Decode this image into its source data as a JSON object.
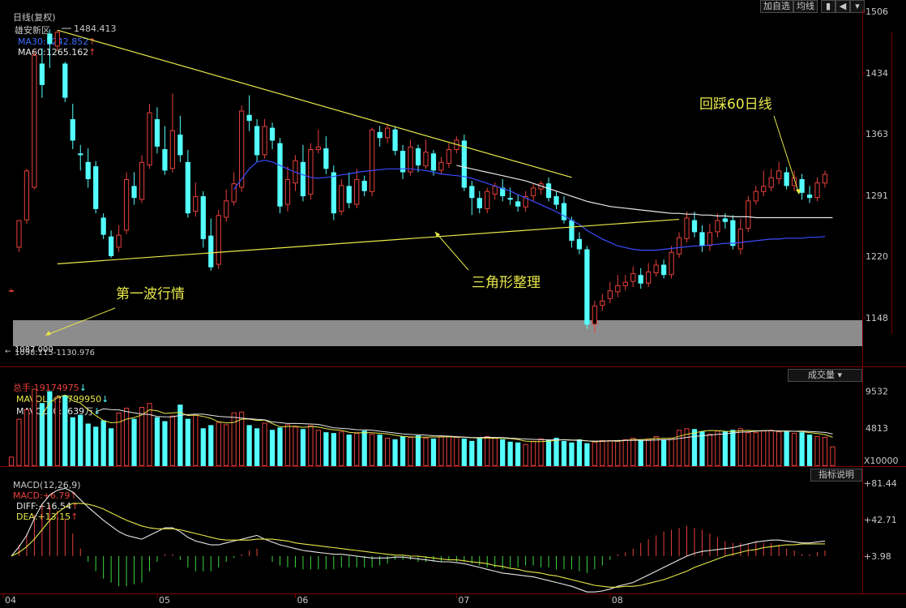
{
  "header": {
    "period_label": "日线(复权)",
    "stock_name": "雄安新区",
    "ma30_label": "MA30:",
    "ma30_value": "1242.852",
    "ma60_label": "MA60:",
    "ma60_value": "1265.162",
    "buttons": [
      "加自选",
      "均线"
    ],
    "arrow_up": "↑"
  },
  "panel_buttons": {
    "volume_type": "成交量",
    "indicator_help": "指标说明",
    "volume_unit": "X10000"
  },
  "colors": {
    "up": "#e8403c",
    "down": "#54ffff",
    "ma30": "#3a4cff",
    "ma60": "#e8e8e8",
    "trend": "#e8e84a",
    "axis": "#7a0000",
    "label_price": "#c8c8c8"
  },
  "volume_header": {
    "total_label": "总手:",
    "total_value": "19174975",
    "mavol5_label": "MAVOL5:",
    "mavol5_value": "27799950",
    "mavol30_label": "MAVOL30:",
    "mavol30_value": "3639万"
  },
  "macd_header": {
    "label": "MACD(12,26,9)",
    "macd_label": "MACD:",
    "macd_value": "+6.79",
    "diff_label": "DIFF:",
    "diff_value": "+16.54",
    "dea_label": "DEA:",
    "dea_value": "+13.15"
  },
  "annotations": {
    "high_label": "1484.413",
    "low_label": "1087.000",
    "gap_label": "1098.115-1130.976",
    "triangle": "三角形整理",
    "first_wave": "第一波行情",
    "pullback": "回踩60日线"
  },
  "chart_data": [
    {
      "type": "candlestick",
      "title": "雄安新区 日线(复权)",
      "price_axis_ticks": [
        1506,
        1434,
        1363,
        1291,
        1220,
        1148
      ],
      "ylim": [
        1100,
        1510
      ],
      "x_tick_labels": [
        "04",
        "05",
        "06",
        "07",
        "08"
      ],
      "x_tick_index": [
        0,
        19,
        37,
        58,
        78
      ],
      "candles": [
        [
          1180,
          1180,
          1178,
          1182
        ],
        [
          1230,
          1262,
          1258,
          1225
        ],
        [
          1262,
          1320,
          1322,
          1258
        ],
        [
          1300,
          1455,
          1460,
          1298
        ],
        [
          1445,
          1420,
          1463,
          1405
        ],
        [
          1480,
          1468,
          1485,
          1440
        ],
        [
          1465,
          1482,
          1484,
          1460
        ],
        [
          1445,
          1405,
          1447,
          1400
        ],
        [
          1380,
          1355,
          1398,
          1345
        ],
        [
          1340,
          1338,
          1350,
          1320
        ],
        [
          1330,
          1310,
          1346,
          1300
        ],
        [
          1325,
          1275,
          1331,
          1270
        ],
        [
          1265,
          1245,
          1270,
          1240
        ],
        [
          1243,
          1220,
          1250,
          1218
        ],
        [
          1230,
          1245,
          1256,
          1225
        ],
        [
          1250,
          1310,
          1318,
          1246
        ],
        [
          1302,
          1288,
          1318,
          1280
        ],
        [
          1286,
          1330,
          1338,
          1282
        ],
        [
          1326,
          1388,
          1398,
          1322
        ],
        [
          1380,
          1348,
          1394,
          1340
        ],
        [
          1345,
          1320,
          1372,
          1315
        ],
        [
          1322,
          1367,
          1410,
          1318
        ],
        [
          1362,
          1338,
          1384,
          1330
        ],
        [
          1330,
          1270,
          1344,
          1265
        ],
        [
          1272,
          1290,
          1306,
          1266
        ],
        [
          1290,
          1240,
          1296,
          1230
        ],
        [
          1244,
          1207,
          1264,
          1203
        ],
        [
          1210,
          1268,
          1274,
          1205
        ],
        [
          1265,
          1285,
          1298,
          1260
        ],
        [
          1283,
          1305,
          1318,
          1279
        ],
        [
          1300,
          1390,
          1396,
          1295
        ],
        [
          1385,
          1378,
          1408,
          1366
        ],
        [
          1372,
          1338,
          1380,
          1330
        ],
        [
          1338,
          1372,
          1380,
          1334
        ],
        [
          1370,
          1355,
          1376,
          1345
        ],
        [
          1352,
          1278,
          1358,
          1270
        ],
        [
          1280,
          1310,
          1325,
          1272
        ],
        [
          1305,
          1332,
          1338,
          1296
        ],
        [
          1330,
          1290,
          1350,
          1284
        ],
        [
          1292,
          1345,
          1352,
          1286
        ],
        [
          1344,
          1348,
          1368,
          1340
        ],
        [
          1346,
          1322,
          1360,
          1316
        ],
        [
          1318,
          1270,
          1326,
          1262
        ],
        [
          1272,
          1303,
          1310,
          1268
        ],
        [
          1302,
          1282,
          1318,
          1276
        ],
        [
          1280,
          1310,
          1322,
          1276
        ],
        [
          1308,
          1296,
          1314,
          1290
        ],
        [
          1295,
          1368,
          1370,
          1290
        ],
        [
          1365,
          1358,
          1372,
          1348
        ],
        [
          1358,
          1370,
          1375,
          1352
        ],
        [
          1368,
          1343,
          1372,
          1338
        ],
        [
          1343,
          1318,
          1350,
          1310
        ],
        [
          1318,
          1348,
          1356,
          1314
        ],
        [
          1346,
          1326,
          1350,
          1318
        ],
        [
          1325,
          1342,
          1356,
          1322
        ],
        [
          1340,
          1320,
          1344,
          1314
        ],
        [
          1320,
          1330,
          1336,
          1316
        ],
        [
          1328,
          1345,
          1352,
          1323
        ],
        [
          1344,
          1356,
          1360,
          1340
        ],
        [
          1355,
          1300,
          1362,
          1296
        ],
        [
          1302,
          1288,
          1308,
          1268
        ],
        [
          1288,
          1276,
          1296,
          1270
        ],
        [
          1275,
          1296,
          1300,
          1270
        ],
        [
          1292,
          1302,
          1306,
          1286
        ],
        [
          1300,
          1290,
          1310,
          1284
        ],
        [
          1288,
          1286,
          1300,
          1280
        ],
        [
          1284,
          1278,
          1292,
          1272
        ],
        [
          1277,
          1290,
          1296,
          1272
        ],
        [
          1290,
          1300,
          1304,
          1284
        ],
        [
          1298,
          1305,
          1308,
          1292
        ],
        [
          1305,
          1288,
          1312,
          1284
        ],
        [
          1290,
          1280,
          1296,
          1275
        ],
        [
          1282,
          1262,
          1290,
          1258
        ],
        [
          1262,
          1238,
          1266,
          1230
        ],
        [
          1240,
          1228,
          1248,
          1222
        ],
        [
          1228,
          1140,
          1232,
          1135
        ],
        [
          1140,
          1162,
          1168,
          1130
        ],
        [
          1162,
          1168,
          1176,
          1156
        ],
        [
          1170,
          1180,
          1190,
          1165
        ],
        [
          1178,
          1186,
          1198,
          1172
        ],
        [
          1185,
          1190,
          1198,
          1180
        ],
        [
          1190,
          1200,
          1208,
          1184
        ],
        [
          1198,
          1188,
          1206,
          1182
        ],
        [
          1188,
          1202,
          1212,
          1184
        ],
        [
          1200,
          1210,
          1216,
          1196
        ],
        [
          1210,
          1198,
          1216,
          1194
        ],
        [
          1198,
          1225,
          1232,
          1194
        ],
        [
          1222,
          1242,
          1248,
          1218
        ],
        [
          1240,
          1265,
          1272,
          1236
        ],
        [
          1262,
          1248,
          1272,
          1242
        ],
        [
          1248,
          1232,
          1256,
          1225
        ],
        [
          1232,
          1248,
          1258,
          1226
        ],
        [
          1248,
          1262,
          1270,
          1242
        ],
        [
          1264,
          1260,
          1270,
          1252
        ],
        [
          1262,
          1232,
          1268,
          1228
        ],
        [
          1228,
          1252,
          1264,
          1222
        ],
        [
          1252,
          1285,
          1290,
          1248
        ],
        [
          1284,
          1296,
          1302,
          1280
        ],
        [
          1295,
          1302,
          1320,
          1290
        ],
        [
          1300,
          1312,
          1322,
          1296
        ],
        [
          1310,
          1320,
          1330,
          1304
        ],
        [
          1318,
          1302,
          1324,
          1298
        ],
        [
          1302,
          1312,
          1320,
          1296
        ],
        [
          1310,
          1294,
          1316,
          1286
        ],
        [
          1292,
          1288,
          1302,
          1282
        ],
        [
          1288,
          1306,
          1312,
          1284
        ],
        [
          1305,
          1316,
          1320,
          1300
        ]
      ],
      "ma30": [
        null,
        null,
        null,
        null,
        null,
        null,
        null,
        null,
        null,
        null,
        null,
        null,
        null,
        null,
        null,
        null,
        null,
        null,
        null,
        null,
        null,
        null,
        null,
        null,
        null,
        null,
        null,
        null,
        null,
        1298,
        1310,
        1322,
        1330,
        1332,
        1330,
        1326,
        1322,
        1318,
        1315,
        1312,
        1311,
        1312,
        1313,
        1315,
        1316,
        1318,
        1319,
        1320,
        1321,
        1322,
        1322,
        1322,
        1322,
        1321,
        1320,
        1318,
        1316,
        1315,
        1314,
        1313,
        1311,
        1308,
        1305,
        1302,
        1299,
        1296,
        1292,
        1288,
        1284,
        1280,
        1276,
        1272,
        1267,
        1262,
        1257,
        1250,
        1245,
        1240,
        1236,
        1232,
        1230,
        1228,
        1227,
        1227,
        1227,
        1228,
        1229,
        1230,
        1231,
        1232,
        1232,
        1233,
        1234,
        1235,
        1235,
        1236,
        1237,
        1238,
        1239,
        1240,
        1240,
        1241,
        1241,
        1241,
        1242,
        1242,
        1243
      ],
      "ma60": [
        null,
        null,
        null,
        null,
        null,
        null,
        null,
        null,
        null,
        null,
        null,
        null,
        null,
        null,
        null,
        null,
        null,
        null,
        null,
        null,
        null,
        null,
        null,
        null,
        null,
        null,
        null,
        null,
        null,
        null,
        null,
        null,
        null,
        null,
        null,
        null,
        null,
        null,
        null,
        null,
        null,
        null,
        null,
        null,
        null,
        null,
        null,
        null,
        null,
        null,
        null,
        null,
        null,
        null,
        null,
        null,
        null,
        null,
        1326,
        1324,
        1322,
        1320,
        1318,
        1316,
        1314,
        1312,
        1310,
        1308,
        1305,
        1302,
        1299,
        1296,
        1293,
        1290,
        1287,
        1284,
        1282,
        1280,
        1278,
        1277,
        1276,
        1275,
        1274,
        1273,
        1272,
        1271,
        1270,
        1270,
        1269,
        1269,
        1268,
        1268,
        1267,
        1267,
        1266,
        1266,
        1266,
        1265,
        1265,
        1265,
        1265,
        1265,
        1265,
        1265,
        1265,
        1265,
        1265,
        1265
      ],
      "trend_lines": [
        {
          "from": [
            6,
            1484
          ],
          "to": [
            73,
            1312
          ]
        },
        {
          "from": [
            6,
            1211
          ],
          "to": [
            87,
            1263
          ]
        }
      ],
      "gap_zone": [
        1098.115,
        1130.976
      ]
    },
    {
      "type": "bar",
      "title": "成交量",
      "ylim": [
        0,
        11000
      ],
      "ticks": [
        9532,
        4813
      ],
      "values": [
        1200,
        6000,
        7200,
        9800,
        8000,
        9500,
        8800,
        9000,
        6200,
        6500,
        5400,
        5000,
        5800,
        4800,
        6800,
        7400,
        6000,
        7500,
        8000,
        6200,
        5700,
        6400,
        7800,
        6000,
        6500,
        4800,
        5200,
        5600,
        5300,
        6800,
        6900,
        5200,
        4800,
        5500,
        4600,
        4900,
        5300,
        5000,
        4700,
        5200,
        4600,
        4300,
        4200,
        4400,
        4000,
        4200,
        4500,
        4100,
        4000,
        3600,
        3400,
        3800,
        3700,
        3900,
        3600,
        3500,
        3800,
        3800,
        3700,
        3500,
        3200,
        3600,
        3800,
        3600,
        3400,
        3100,
        3000,
        2800,
        3200,
        3500,
        3300,
        3600,
        3200,
        3000,
        3400,
        2900,
        3100,
        3300,
        3300,
        3200,
        3400,
        3600,
        3300,
        3500,
        3800,
        3400,
        3600,
        4600,
        4800,
        4700,
        4400,
        4100,
        4500,
        4400,
        4600,
        4800,
        4300,
        4300,
        4500,
        4600,
        4400,
        4400,
        4200,
        4300,
        4000,
        3800,
        3700,
        2500
      ],
      "series": [
        {
          "name": "MAVOL5",
          "values": []
        },
        {
          "name": "MAVOL30",
          "values": []
        }
      ]
    },
    {
      "type": "line",
      "title": "MACD(12,26,9)",
      "ticks": [
        81.44,
        42.71,
        3.98
      ],
      "ylim": [
        -40,
        90
      ],
      "diff": [
        0,
        10,
        22,
        40,
        55,
        65,
        70,
        72,
        68,
        60,
        52,
        45,
        38,
        32,
        26,
        22,
        20,
        18,
        22,
        26,
        30,
        30,
        26,
        20,
        16,
        14,
        12,
        12,
        14,
        16,
        18,
        20,
        22,
        18,
        15,
        12,
        10,
        8,
        6,
        5,
        4,
        3,
        2,
        2,
        1,
        0,
        -1,
        -2,
        -2,
        -2,
        -1,
        -1,
        -2,
        -3,
        -4,
        -5,
        -6,
        -6,
        -7,
        -8,
        -10,
        -12,
        -14,
        -16,
        -18,
        -19,
        -20,
        -21,
        -22,
        -24,
        -26,
        -28,
        -30,
        -32,
        -35,
        -38,
        -38,
        -37,
        -35,
        -32,
        -30,
        -28,
        -24,
        -20,
        -16,
        -12,
        -8,
        -4,
        0,
        3,
        5,
        6,
        7,
        8,
        9,
        11,
        13,
        15,
        16,
        17,
        17,
        16,
        15,
        14,
        14,
        15,
        16
      ],
      "dea": [
        0,
        4,
        10,
        18,
        28,
        38,
        46,
        52,
        56,
        56,
        55,
        53,
        50,
        46,
        42,
        38,
        35,
        32,
        30,
        29,
        29,
        29,
        28,
        26,
        24,
        22,
        20,
        18,
        17,
        17,
        17,
        17,
        18,
        18,
        18,
        17,
        16,
        14,
        13,
        12,
        11,
        10,
        9,
        8,
        7,
        6,
        5,
        4,
        3,
        2,
        1,
        1,
        0,
        0,
        -1,
        -2,
        -3,
        -4,
        -4,
        -5,
        -6,
        -7,
        -8,
        -10,
        -11,
        -13,
        -14,
        -16,
        -17,
        -18,
        -20,
        -21,
        -23,
        -25,
        -27,
        -29,
        -31,
        -32,
        -33,
        -33,
        -32,
        -32,
        -31,
        -29,
        -27,
        -25,
        -22,
        -19,
        -16,
        -12,
        -9,
        -6,
        -3,
        0,
        2,
        4,
        6,
        7,
        9,
        10,
        11,
        12,
        12,
        13,
        13,
        13,
        13
      ]
    }
  ]
}
